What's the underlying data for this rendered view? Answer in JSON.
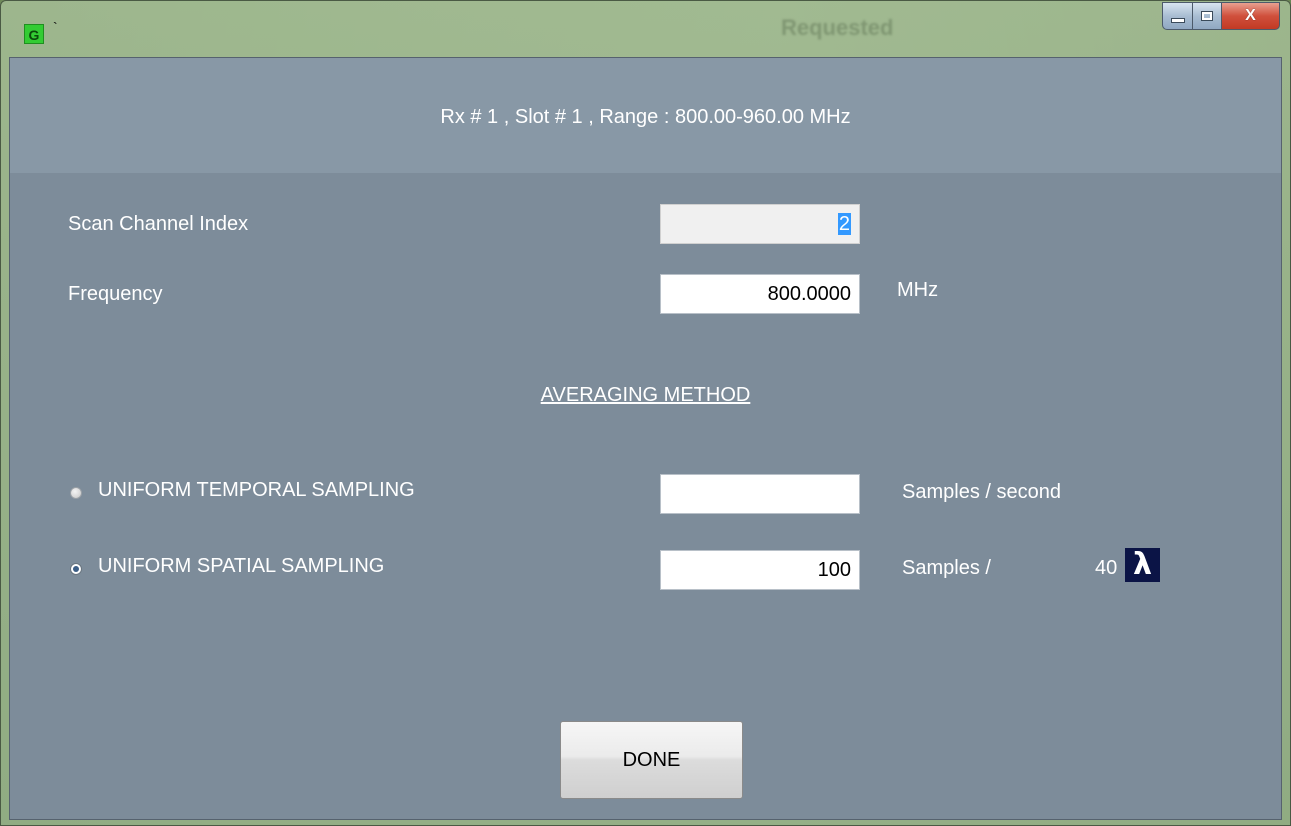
{
  "window": {
    "title": "`",
    "app_icon_letter": "G",
    "background_title_ghost": "Requested",
    "controls": {
      "minimize_icon": "minimize-icon",
      "maximize_icon": "maximize-icon",
      "close_icon": "close-icon",
      "close_glyph": "X"
    }
  },
  "header": {
    "text": "Rx # 1 , Slot # 1 , Range : 800.00-960.00 MHz"
  },
  "scan_channel": {
    "label": "Scan Channel Index",
    "value": "2"
  },
  "frequency": {
    "label": "Frequency",
    "value": "800.0000",
    "unit": "MHz"
  },
  "averaging": {
    "title": "AVERAGING METHOD",
    "temporal": {
      "label": "UNIFORM TEMPORAL SAMPLING",
      "value": "",
      "unit": "Samples / second",
      "selected": false
    },
    "spatial": {
      "label": "UNIFORM SPATIAL SAMPLING",
      "value": "100",
      "unit": "Samples /",
      "wavelengths": "40",
      "wavelength_symbol": "λ",
      "selected": true
    }
  },
  "done_button": {
    "label": "DONE"
  },
  "colors": {
    "client_bg": "#7d8c9a",
    "header_bg": "#8898a6",
    "lambda_bg": "#0b1446",
    "selection": "#3399ff"
  }
}
